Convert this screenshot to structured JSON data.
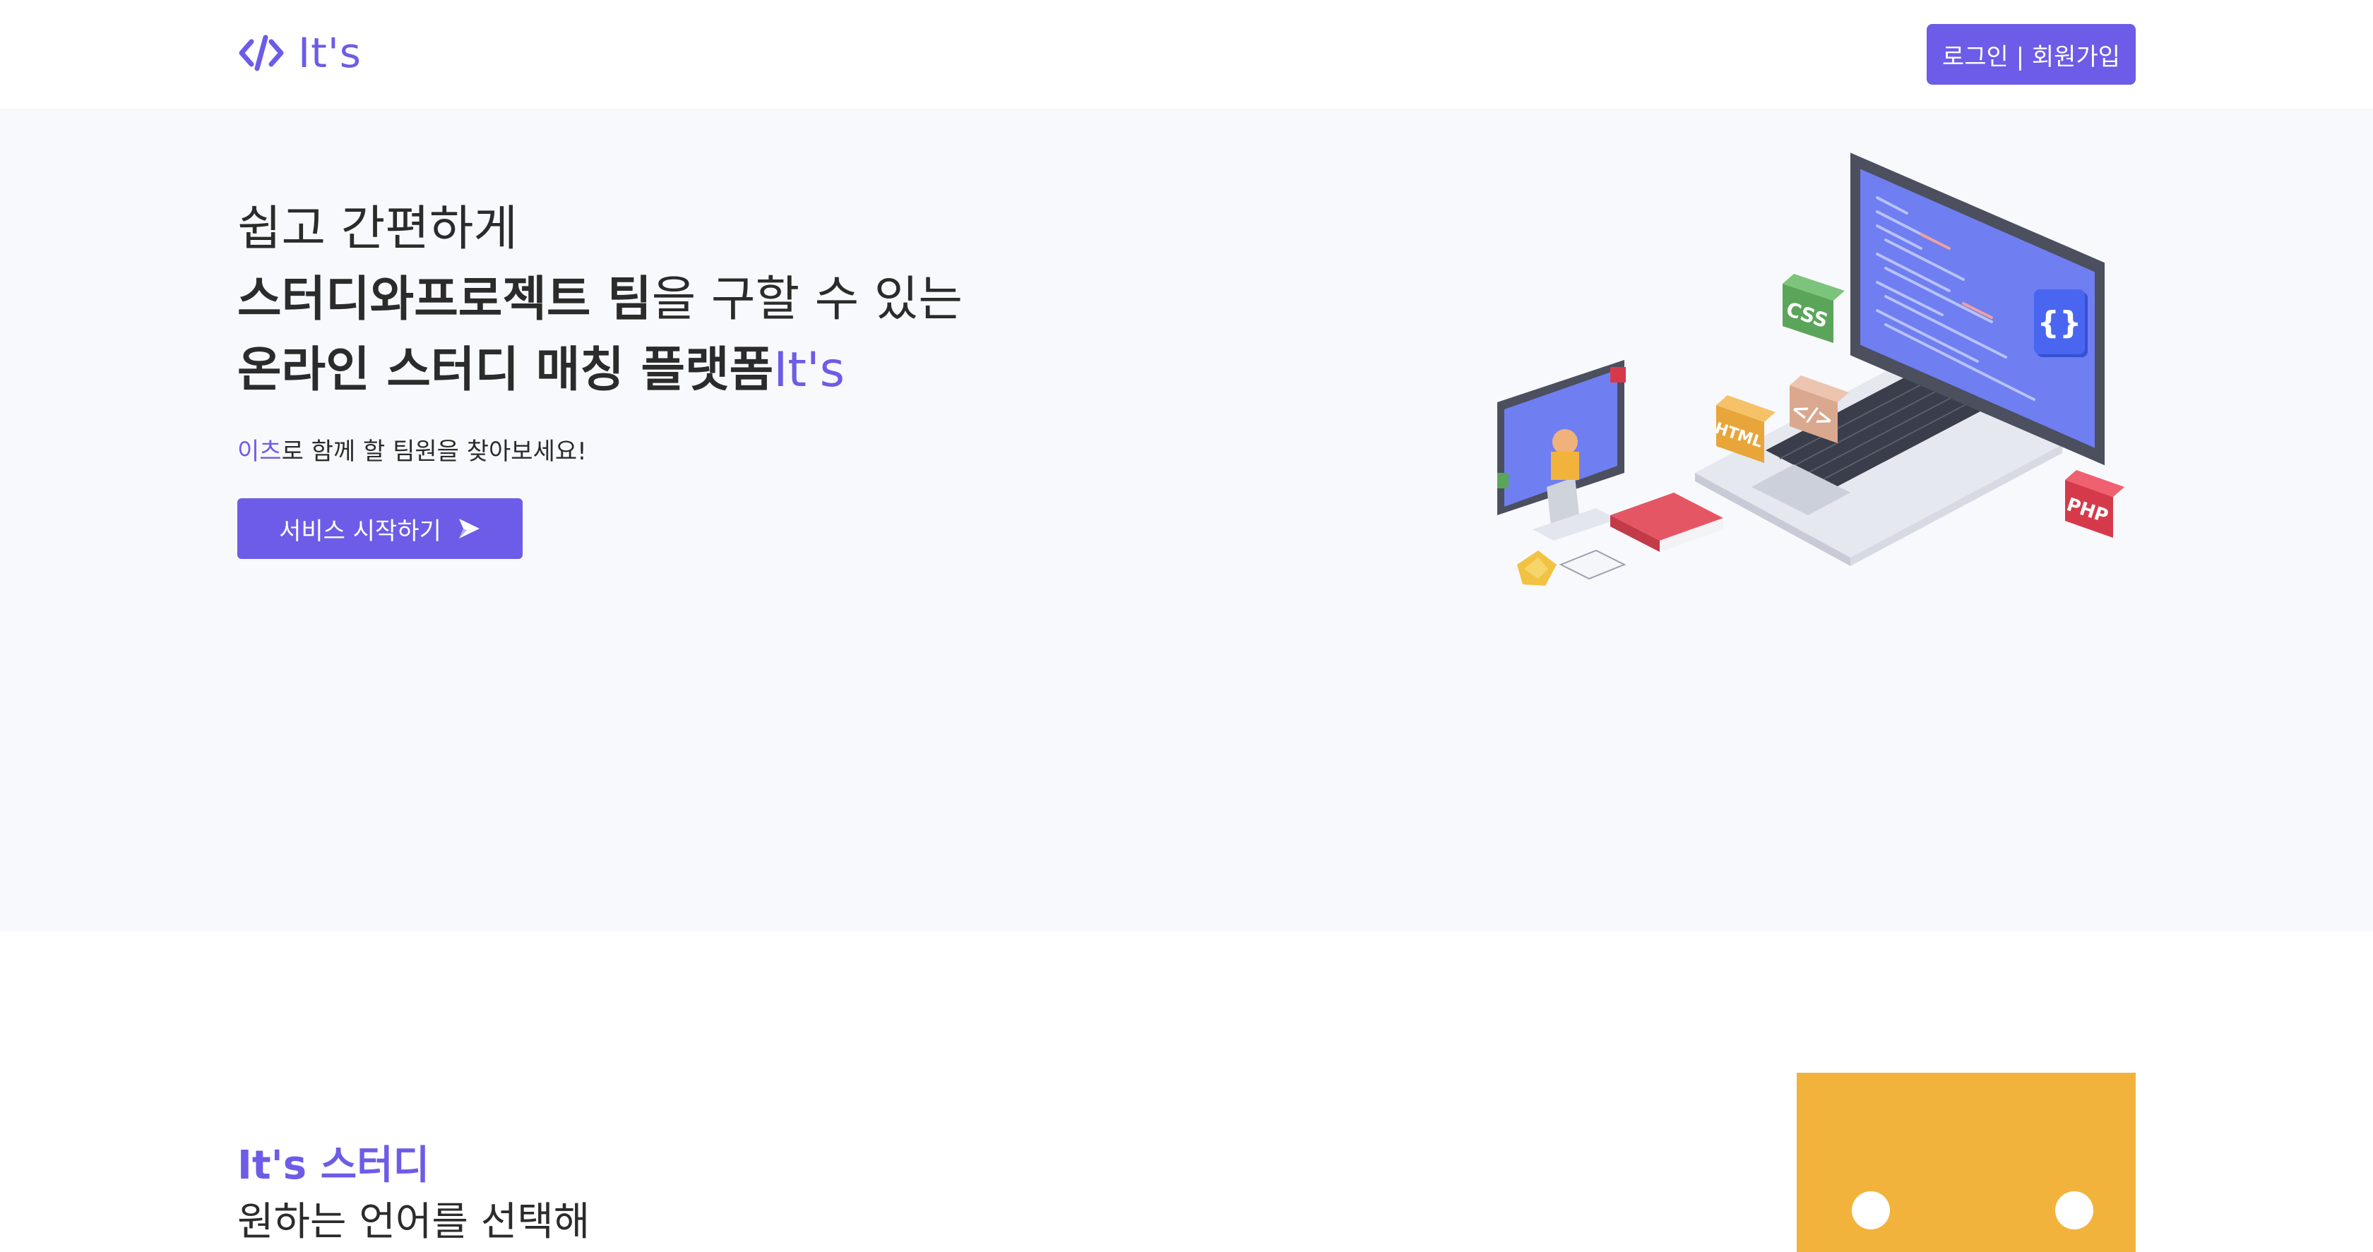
{
  "header": {
    "logo_text": "It's",
    "auth_button": "로그인 | 회원가입"
  },
  "hero": {
    "line1": "쉽고 간편하게",
    "line2_bold": "스터디와프로젝트 팀",
    "line2_rest": "을 구할 수 있는",
    "line3_bold": "온라인 스터디 매칭 플랫폼",
    "line3_accent": "It's",
    "sub_accent": "이츠",
    "sub_rest": "로 함께 할 팀원을 찾아보세요!",
    "start_button": "서비스 시작하기",
    "illustration": {
      "tiles": [
        "CSS",
        "HTML",
        "</>",
        "PHP",
        "{}"
      ]
    }
  },
  "study_section": {
    "title": "It's 스터디",
    "subtitle": "원하는 언어를 선택해"
  },
  "colors": {
    "accent": "#6c5ce7",
    "hero_bg": "#f8f9fc",
    "card_yellow": "#f2b33d"
  }
}
